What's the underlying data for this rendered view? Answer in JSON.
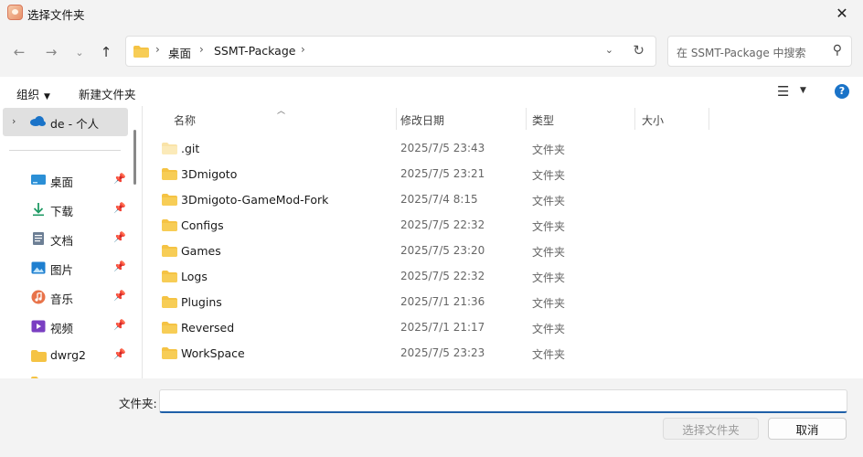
{
  "window": {
    "title": "选择文件夹"
  },
  "nav": {
    "breadcrumb": [
      "桌面",
      "SSMT-Package"
    ],
    "search_placeholder": "在 SSMT-Package 中搜索"
  },
  "toolbar": {
    "organize": "组织",
    "new_folder": "新建文件夹"
  },
  "sidebar": {
    "selected": "de - 个人",
    "items": [
      {
        "label": "桌面",
        "icon": "desktop-icon"
      },
      {
        "label": "下载",
        "icon": "download-icon"
      },
      {
        "label": "文档",
        "icon": "document-icon"
      },
      {
        "label": "图片",
        "icon": "picture-icon"
      },
      {
        "label": "音乐",
        "icon": "music-icon"
      },
      {
        "label": "视频",
        "icon": "video-icon"
      },
      {
        "label": "dwrg2",
        "icon": "folder-icon"
      }
    ]
  },
  "columns": {
    "name": "名称",
    "date": "修改日期",
    "type": "类型",
    "size": "大小"
  },
  "files": [
    {
      "name": ".git",
      "date": "2025/7/5 23:43",
      "type": "文件夹",
      "hidden": true
    },
    {
      "name": "3Dmigoto",
      "date": "2025/7/5 23:21",
      "type": "文件夹"
    },
    {
      "name": "3Dmigoto-GameMod-Fork",
      "date": "2025/7/4 8:15",
      "type": "文件夹"
    },
    {
      "name": "Configs",
      "date": "2025/7/5 22:32",
      "type": "文件夹"
    },
    {
      "name": "Games",
      "date": "2025/7/5 23:20",
      "type": "文件夹"
    },
    {
      "name": "Logs",
      "date": "2025/7/5 22:32",
      "type": "文件夹"
    },
    {
      "name": "Plugins",
      "date": "2025/7/1 21:36",
      "type": "文件夹"
    },
    {
      "name": "Reversed",
      "date": "2025/7/1 21:17",
      "type": "文件夹"
    },
    {
      "name": "WorkSpace",
      "date": "2025/7/5 23:23",
      "type": "文件夹"
    }
  ],
  "footer": {
    "folder_label": "文件夹:",
    "folder_value": "",
    "select_button": "选择文件夹",
    "cancel_button": "取消"
  },
  "colors": {
    "folder": "#f5c344",
    "accent": "#1f5fa8"
  }
}
